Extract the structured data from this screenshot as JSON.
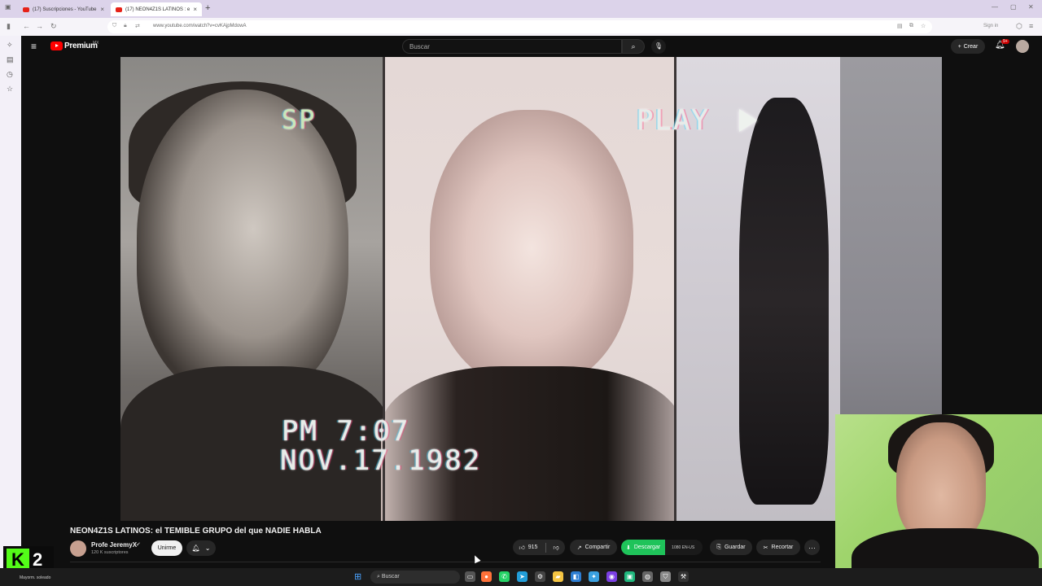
{
  "browser": {
    "tabs": [
      {
        "label": "(17) Suscripciones - YouTube",
        "active": false
      },
      {
        "label": "(17) NEON4Z1S LATINOS : e",
        "active": true
      }
    ],
    "new_tab": "+",
    "url": "www.youtube.com/watch?v=cvKAjpMdowA",
    "sign_in": "Sign in"
  },
  "youtube": {
    "logo_text": "Premium",
    "logo_region": "MX",
    "search_placeholder": "Buscar",
    "create_label": "Crear",
    "notif_count": "9+"
  },
  "video": {
    "overlay": {
      "sp": "SP",
      "play": "PLAY",
      "time": "PM 7:07",
      "date": "NOV.17.1982"
    },
    "title": "NEON4Z1S LATINOS: el TEMIBLE GRUPO del que NADIE HABLA",
    "channel": {
      "name": "Profe JeremyX",
      "subscribers": "120 K suscriptores"
    },
    "join_label": "Unirme",
    "likes": "915",
    "share_label": "Compartir",
    "download_label": "Descargar",
    "download_quality": "1080 EN-US",
    "save_label": "Guardar",
    "clip_label": "Recortar",
    "more_label": "···"
  },
  "stream": {
    "kick_number": "2"
  },
  "taskbar": {
    "weather": "Mayorm. soleado",
    "search_label": "Buscar"
  },
  "colors": {
    "youtube_red": "#ff0000",
    "download_green": "#1fc35a",
    "kick_green": "#53fc18",
    "tab_strip": "#dcd3ea"
  }
}
